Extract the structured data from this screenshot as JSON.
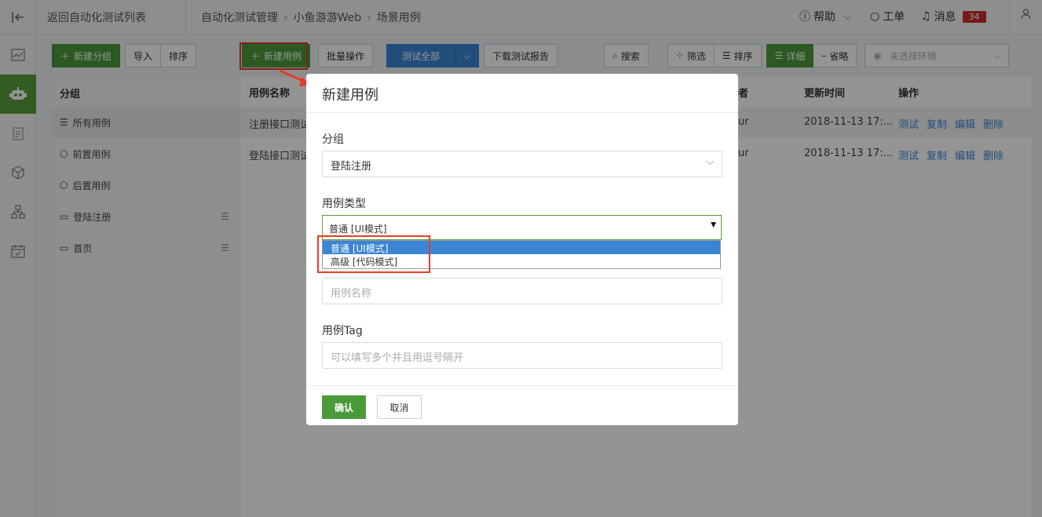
{
  "topbar": {
    "back_label": "返回自动化测试列表",
    "breadcrumb": [
      "自动化测试管理",
      "小鱼游游Web",
      "场景用例"
    ],
    "help": "帮助",
    "tickets": "工单",
    "messages": "消息",
    "message_count": "34"
  },
  "toolbar": {
    "new_group": "新建分组",
    "import": "导入",
    "sort": "排序",
    "new_case": "新建用例",
    "batch": "批量操作",
    "test_all": "测试全部",
    "download_report": "下载测试报告",
    "search": "搜索",
    "filter": "筛选",
    "sort2": "排序",
    "detail": "详细",
    "brief": "省略",
    "env_placeholder": "未选择环境"
  },
  "groups": {
    "header": "分组",
    "items": [
      "所有用例",
      "前置用例",
      "后置用例",
      "登陆注册",
      "首页"
    ]
  },
  "table": {
    "headers": {
      "name": "用例名称",
      "author": "者",
      "updated": "更新时间",
      "actions": "操作"
    },
    "rows": [
      {
        "name": "注册接口测试",
        "author": "ur",
        "updated": "2018-11-13 17:..."
      },
      {
        "name": "登陆接口测试",
        "author": "ur",
        "updated": "2018-11-13 17:..."
      }
    ],
    "actions": [
      "测试",
      "复制",
      "编辑",
      "删除"
    ]
  },
  "modal": {
    "title": "新建用例",
    "group_label": "分组",
    "group_value": "登陆注册",
    "type_label": "用例类型",
    "type_value": "普通 [UI模式]",
    "type_options": [
      "普通 [UI模式]",
      "高级 [代码模式]"
    ],
    "name_placeholder": "用例名称",
    "tag_label": "用例Tag",
    "tag_placeholder": "可以填写多个并且用逗号隔开",
    "confirm": "确认",
    "cancel": "取消"
  }
}
